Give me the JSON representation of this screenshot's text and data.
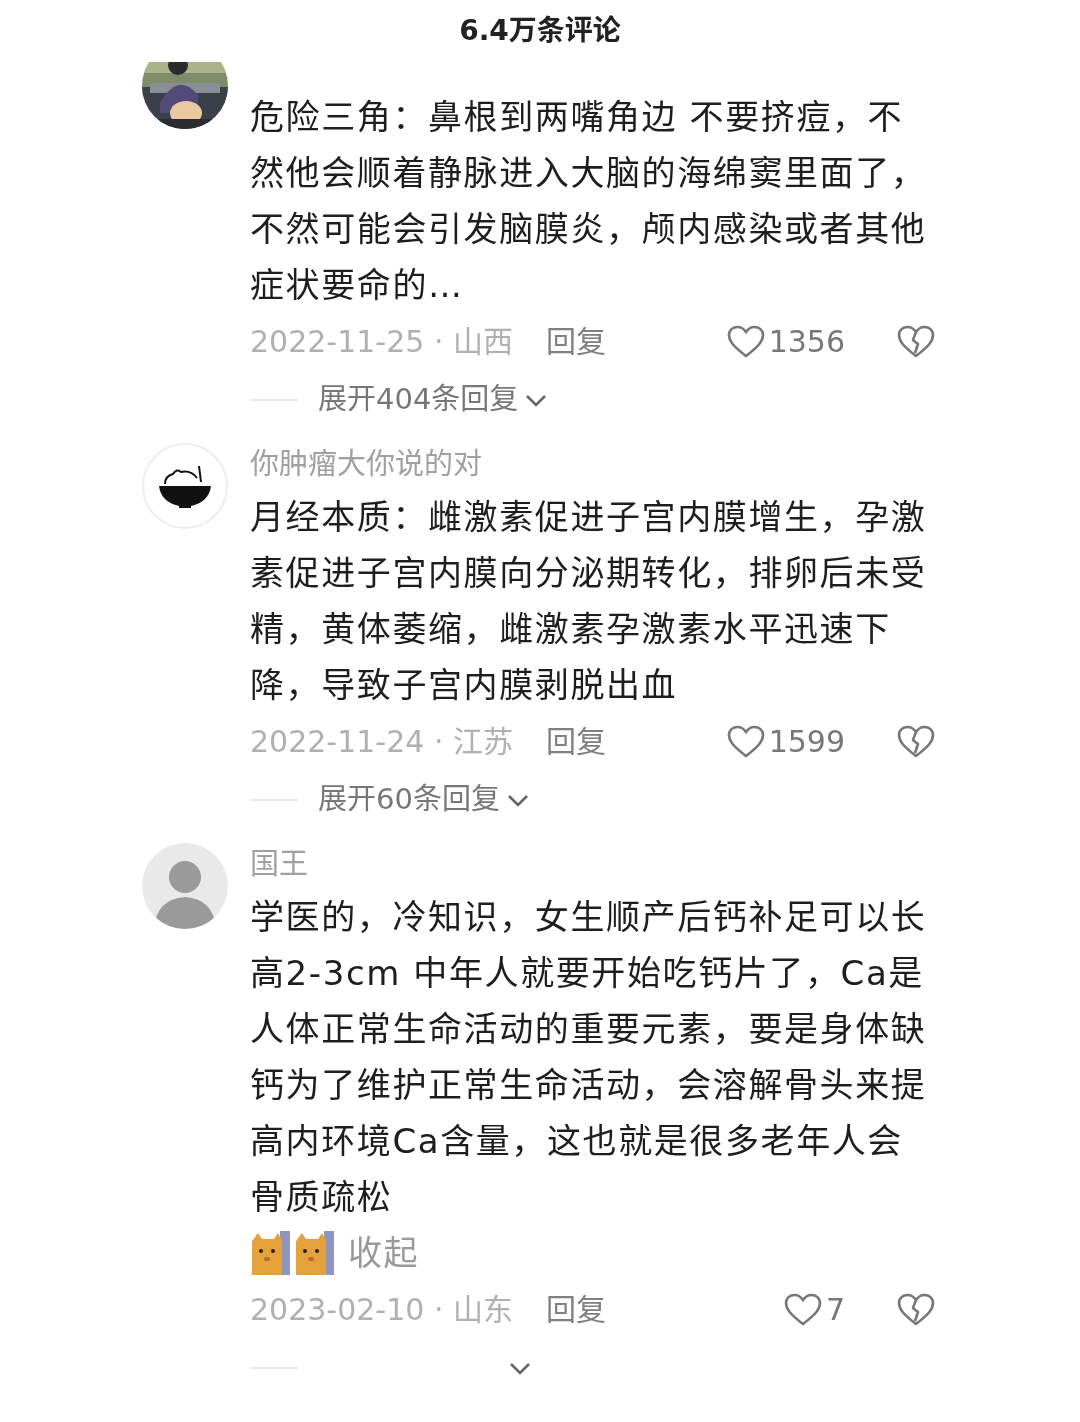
{
  "header": {
    "title": "6.4万条评论"
  },
  "comments": [
    {
      "body": "危险三角：鼻根到两嘴角边 不要挤痘，不然他会顺着静脉进入大脑的海绵窦里面了，不然可能会引发脑膜炎，颅内感染或者其他症状要命的…",
      "date": "2022-11-25 · 山西",
      "reply": "回复",
      "likes": "1356",
      "expand": {
        "kind": "label",
        "label": "展开404条回复"
      }
    },
    {
      "avatar": {
        "kind": "cat-bowl"
      },
      "username": "你肿瘤大你说的对",
      "body": "月经本质：雌激素促进子宫内膜增生，孕激素促进子宫内膜向分泌期转化，排卵后未受精，黄体萎缩，雌激素孕激素水平迅速下降，导致子宫内膜剥脱出血",
      "date": "2022-11-24 · 江苏",
      "reply": "回复",
      "likes": "1599",
      "expand": {
        "kind": "label",
        "label": "展开60条回复"
      }
    },
    {
      "avatar": {
        "kind": "silhouette"
      },
      "username": "国王",
      "body": "学医的，冷知识，女生顺产后钙补足可以长高2-3cm  中年人就要开始吃钙片了，Ca是人体正常生命活动的重要元素，要是身体缺钙为了维护正常生命活动，会溶解骨头来提高内环境Ca含量，这也就是很多老年人会骨质疏松",
      "emojis": [
        {
          "kind": "cat"
        },
        {
          "kind": "cat"
        }
      ],
      "collapse": "收起",
      "date": "2023-02-10 · 山东",
      "reply": "回复",
      "likes": "7",
      "expand": {
        "kind": "cut"
      }
    }
  ]
}
